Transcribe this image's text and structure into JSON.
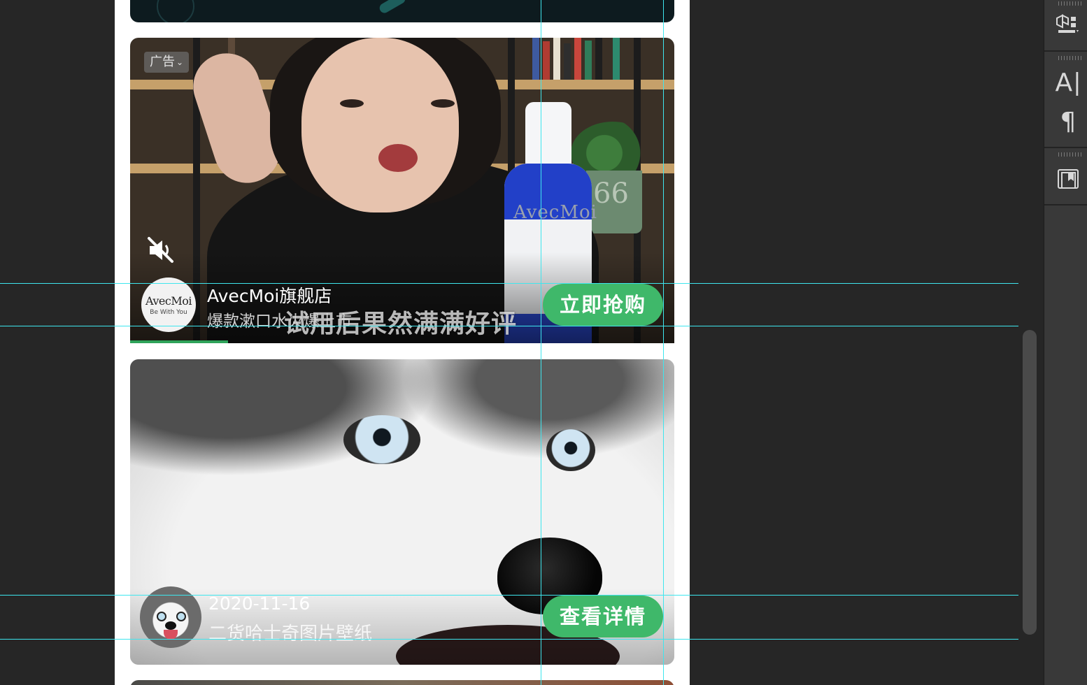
{
  "feed": {
    "ad": {
      "tag": "广告",
      "store_name": "AvecMoi旗舰店",
      "description": "爆款漱口水火爆上市",
      "caption": "试用后果然满满好评",
      "cta": "立即抢购",
      "avatar_logo": "AvecMoi",
      "avatar_slogan": "Be With You",
      "bottle_label": "AvecMoi",
      "pot_number": "66"
    },
    "post": {
      "date": "2020-11-16",
      "title": "二货哈士奇图片壁纸",
      "cta": "查看详情"
    }
  },
  "tool_panel": {
    "tools": [
      "3d-cube-icon",
      "character-icon",
      "paragraph-icon",
      "glyphs-icon"
    ],
    "character_glyph": "A",
    "paragraph_glyph": "¶"
  },
  "colors": {
    "cta_green": "#3fb86a",
    "guide_cyan": "#3ee6ee",
    "canvas_bg": "#262626",
    "panel_bg": "#393939"
  }
}
